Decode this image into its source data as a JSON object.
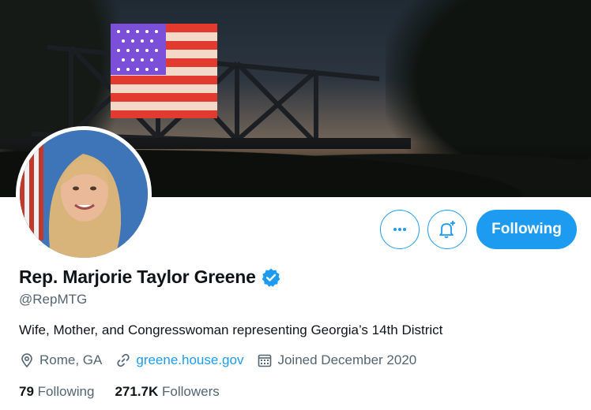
{
  "profile": {
    "name": "Rep. Marjorie Taylor Greene",
    "handle": "@RepMTG",
    "bio": "Wife, Mother, and Congresswoman representing Georgia’s 14th District",
    "location": "Rome, GA",
    "website": "greene.house.gov",
    "joined": "Joined December 2020",
    "following_count": "79",
    "following_label": "Following",
    "followers_count": "271.7K",
    "followers_label": "Followers",
    "verified": true
  },
  "actions": {
    "more_icon": "more-horizontal-icon",
    "notify_icon": "bell-plus-icon",
    "follow_label": "Following"
  },
  "colors": {
    "accent": "#1d9bf0",
    "text": "#0f1419",
    "secondary": "#536471"
  }
}
